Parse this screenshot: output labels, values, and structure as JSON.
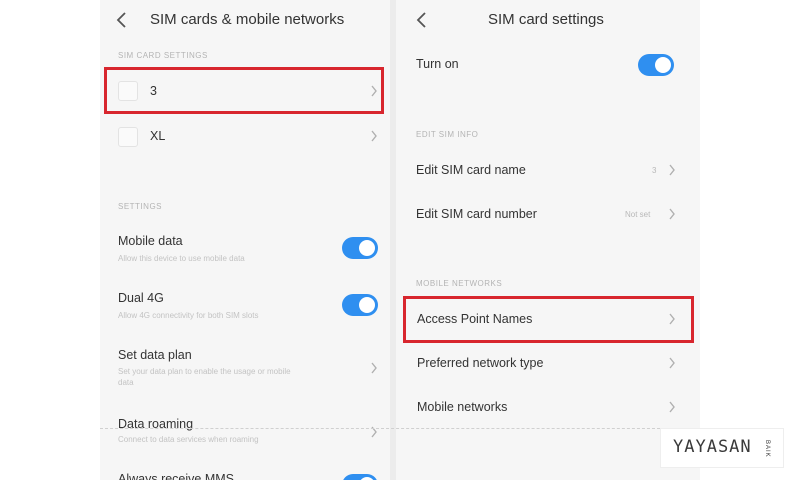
{
  "left": {
    "title": "SIM cards & mobile networks",
    "sim_section_label": "SIM card settings",
    "sims": [
      {
        "name": "3"
      },
      {
        "name": "XL"
      }
    ],
    "settings_section_label": "Settings",
    "mobile_data": {
      "title": "Mobile data",
      "subtitle": "Allow this device to use mobile data",
      "on": true
    },
    "dual_4g": {
      "title": "Dual 4G",
      "subtitle": "Allow 4G connectivity for both SIM slots",
      "on": true
    },
    "data_plan": {
      "title": "Set data plan",
      "subtitle_line1": "Set your data plan to enable the usage or mobile",
      "subtitle_line2": "data"
    },
    "roaming": {
      "title": "Data roaming",
      "subtitle": "Connect to data services when roaming"
    },
    "mms": {
      "title": "Always receive MMS"
    }
  },
  "right": {
    "title": "SIM card settings",
    "turn_on": {
      "title": "Turn on",
      "on": true
    },
    "edit_section_label": "Edit SIM info",
    "edit_name": {
      "title": "Edit SIM card name",
      "value": "3"
    },
    "edit_number": {
      "title": "Edit SIM card number",
      "value": "Not set"
    },
    "network_section_label": "Mobile networks",
    "apn": {
      "title": "Access Point Names"
    },
    "network_type": {
      "title": "Preferred network type"
    },
    "mobile_networks": {
      "title": "Mobile networks"
    }
  },
  "watermark": {
    "main": "YAYASAN",
    "small": "BAIK"
  },
  "colors": {
    "accent": "#2f8ff0",
    "highlight": "#d8262e",
    "panel_bg": "#f6f6f6"
  },
  "icons": [
    "back-icon",
    "chevron-right-icon",
    "sim-icon",
    "toggle-switch"
  ]
}
